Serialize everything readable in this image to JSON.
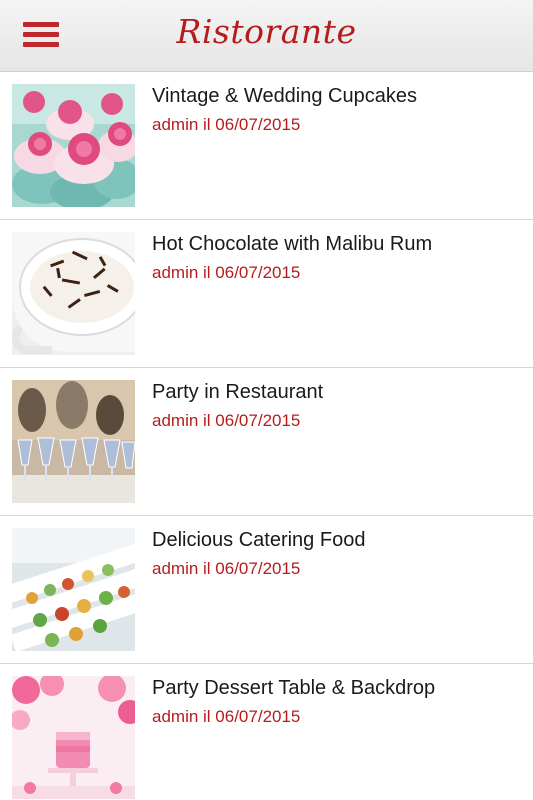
{
  "app": {
    "title": "Ristorante",
    "accent_color": "#b71c1c"
  },
  "header": {
    "menu_icon": "hamburger-menu-icon"
  },
  "posts": [
    {
      "title": "Vintage & Wedding Cupcakes",
      "meta": "admin il 06/07/2015",
      "image": "pink-rose-cupcakes"
    },
    {
      "title": "Hot Chocolate with Malibu Rum",
      "meta": "admin il 06/07/2015",
      "image": "hot-chocolate-cup"
    },
    {
      "title": "Party in Restaurant",
      "meta": "admin il 06/07/2015",
      "image": "wine-glasses-party"
    },
    {
      "title": "Delicious Catering Food",
      "meta": "admin il 06/07/2015",
      "image": "catering-buffet"
    },
    {
      "title": "Party Dessert Table & Backdrop",
      "meta": "admin il 06/07/2015",
      "image": "pink-dessert-table"
    }
  ]
}
